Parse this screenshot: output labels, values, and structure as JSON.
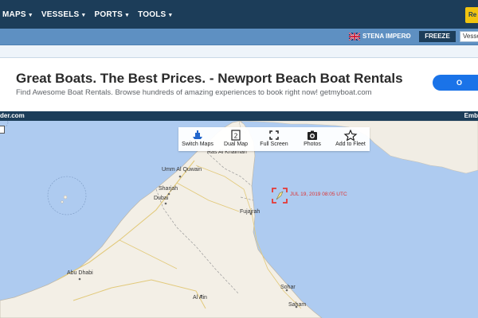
{
  "nav": {
    "items": [
      {
        "label": "MAPS"
      },
      {
        "label": "VESSELS"
      },
      {
        "label": "PORTS"
      },
      {
        "label": "TOOLS"
      }
    ],
    "right_button_label": "Re"
  },
  "strip": {
    "vessel_name": "STENA IMPERO",
    "close_label": "x",
    "freeze_label": "FREEZE",
    "search_value": "Vesse"
  },
  "ad": {
    "title": "Great Boats. The Best Prices. - Newport Beach Boat Rentals",
    "subtitle": "Find Awesome Boat Rentals. Browse hundreds of amazing experiences to book right now! getmyboat.com",
    "button_label": "O"
  },
  "map_bar": {
    "left_text": "der.com",
    "right_text": "Emb"
  },
  "toolbar": {
    "switch_maps": "Switch Maps",
    "dual_map": "Dual Map",
    "full_screen": "Full Screen",
    "photos": "Photos",
    "add_to_fleet": "Add to Fleet"
  },
  "vessel": {
    "timestamp": "JUL 19, 2019 08:05 UTC"
  },
  "cities": {
    "umm_al_quwain": "Umm Al Quwain",
    "sharjah": "Sharjah",
    "dubai": "Dubai",
    "fujairah": "Fujairah",
    "abu_dhabi": "Abu Dhabi",
    "al_ain": "Al Ain",
    "sohar": "Sohar",
    "saham": "Saham",
    "ras_al_khaimah": "Ras Al Khaimah"
  },
  "colors": {
    "nav_bg": "#1c3d59",
    "strip_bg": "#5e90c2",
    "sea": "#aecbf0",
    "land": "#f1ede4",
    "ad_button": "#1a73e8",
    "vessel_marker": "#e53935"
  }
}
